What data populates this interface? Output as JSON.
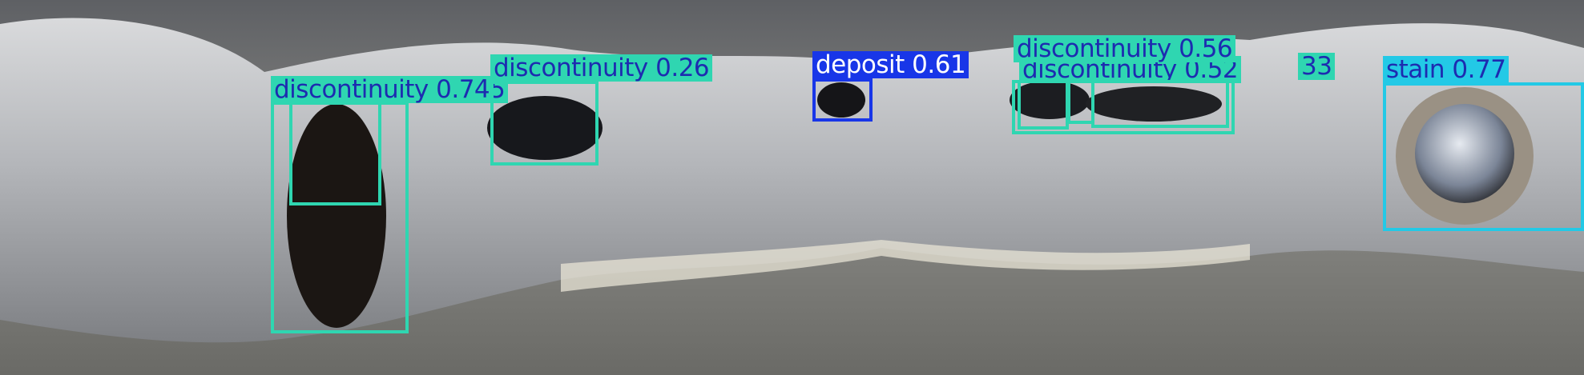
{
  "colors": {
    "discontinuity": "#2fd6b1",
    "deposit": "#1836e8",
    "stain": "#23c9e6",
    "label_text_dark": "#1d2bb0",
    "label_text_light": "#ffffff"
  },
  "image": {
    "subject": "welded-metal-bead",
    "icon": "weld-seam-photo"
  },
  "detections": {
    "disc_074": {
      "text": "discontinuity 0.745"
    },
    "disc_026": {
      "text": "discontinuity 0.26"
    },
    "deposit_061": {
      "text": "deposit 0.61"
    },
    "disc_056": {
      "text": "discontinuity 0.56"
    },
    "disc_052": {
      "text": "discontinuity 0.52"
    },
    "disc_033": {
      "text": "33"
    },
    "stain_077": {
      "text": "stain 0.77"
    }
  }
}
